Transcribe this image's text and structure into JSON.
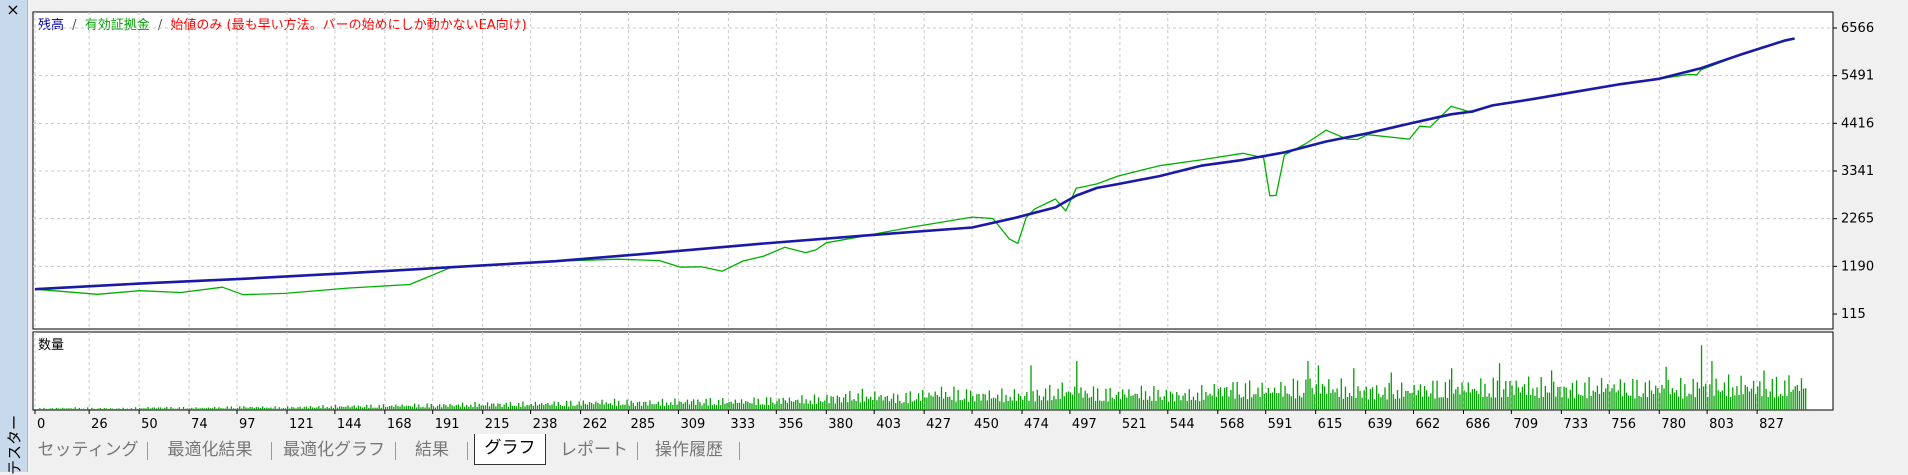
{
  "window": {
    "close_glyph": "×",
    "side_label": "テスター"
  },
  "legend": {
    "balance": "残高",
    "equity": "有効証拠金",
    "note": "始値のみ (最も早い方法。バーの始めにしか動かないEA向け)",
    "separator": "/",
    "colors": {
      "balance": "#0000a0",
      "equity": "#00a000",
      "note": "#ff0000"
    }
  },
  "volume_label": "数量",
  "tabs": [
    {
      "label": "セッティング",
      "active": false
    },
    {
      "label": "最適化結果",
      "active": false
    },
    {
      "label": "最適化グラフ",
      "active": false
    },
    {
      "label": "結果",
      "active": false
    },
    {
      "label": "グラフ",
      "active": true
    },
    {
      "label": "レポート",
      "active": false
    },
    {
      "label": "操作履歴",
      "active": false
    }
  ],
  "chart_data": {
    "type": "line",
    "y_ticks": [
      115,
      1190,
      2265,
      3341,
      4416,
      5491,
      6566
    ],
    "ylim": [
      115,
      6566
    ],
    "x_ticks": [
      0,
      26,
      50,
      74,
      97,
      121,
      144,
      168,
      191,
      215,
      238,
      262,
      285,
      309,
      333,
      356,
      380,
      403,
      427,
      450,
      474,
      497,
      521,
      544,
      568,
      591,
      615,
      639,
      662,
      686,
      709,
      733,
      756,
      780,
      803,
      827
    ],
    "xlim": [
      0,
      850
    ],
    "grid": true,
    "colors": {
      "balance": "#1a1aa6",
      "equity": "#00b000",
      "volume": "#00a000"
    },
    "series": [
      {
        "name": "残高",
        "x": [
          0,
          50,
          100,
          150,
          200,
          250,
          300,
          350,
          400,
          450,
          470,
          490,
          500,
          510,
          520,
          540,
          560,
          580,
          600,
          620,
          640,
          660,
          680,
          690,
          700,
          720,
          740,
          760,
          780,
          800,
          820,
          840,
          845
        ],
        "y": [
          675,
          800,
          910,
          1035,
          1170,
          1305,
          1500,
          1705,
          1890,
          2065,
          2275,
          2520,
          2785,
          2960,
          3045,
          3225,
          3460,
          3590,
          3760,
          4005,
          4190,
          4410,
          4620,
          4680,
          4820,
          4970,
          5130,
          5290,
          5420,
          5660,
          5980,
          6280,
          6330
        ]
      },
      {
        "name": "有効証拠金",
        "x": [
          0,
          30,
          50,
          70,
          90,
          100,
          120,
          150,
          180,
          200,
          250,
          280,
          300,
          310,
          320,
          330,
          340,
          350,
          360,
          370,
          375,
          380,
          400,
          420,
          450,
          460,
          468,
          472,
          476,
          480,
          490,
          495,
          500,
          505,
          510,
          520,
          540,
          560,
          580,
          590,
          593,
          596,
          600,
          610,
          620,
          630,
          635,
          640,
          660,
          665,
          670,
          680,
          690,
          700,
          720,
          740,
          760,
          780,
          790,
          794,
          798,
          800,
          820,
          840,
          845
        ],
        "y": [
          675,
          560,
          640,
          600,
          720,
          550,
          580,
          700,
          780,
          1170,
          1305,
          1350,
          1320,
          1170,
          1180,
          1080,
          1310,
          1420,
          1620,
          1500,
          1560,
          1720,
          1890,
          2065,
          2300,
          2270,
          1805,
          1710,
          2290,
          2480,
          2710,
          2440,
          2950,
          3000,
          3050,
          3225,
          3460,
          3590,
          3740,
          3640,
          2780,
          2790,
          3700,
          3950,
          4260,
          4060,
          4050,
          4160,
          4060,
          4350,
          4330,
          4800,
          4660,
          4820,
          4980,
          5130,
          5290,
          5420,
          5490,
          5520,
          5510,
          5620,
          5980,
          6280,
          6330
        ]
      }
    ],
    "volume": {
      "heights": [
        0.03,
        0.04,
        0.03,
        0.05,
        0.04,
        0.06,
        0.05,
        0.07,
        0.08,
        0.09,
        0.1,
        0.12,
        0.12,
        0.14,
        0.16,
        0.15,
        0.18,
        0.17,
        0.2,
        0.22,
        0.3,
        0.25,
        0.35,
        0.3,
        0.3,
        0.4,
        0.33,
        0.35,
        0.3,
        0.45,
        0.4,
        0.5,
        0.42,
        0.38,
        0.45,
        0.45,
        0.5,
        0.43,
        0.48,
        0.46,
        0.45,
        0.5,
        0.48,
        0.52
      ],
      "spikes": [
        [
          478,
          0.62
        ],
        [
          500,
          0.68
        ],
        [
          611,
          0.68
        ],
        [
          616,
          0.62
        ],
        [
          633,
          0.58
        ],
        [
          651,
          0.52
        ],
        [
          680,
          0.58
        ],
        [
          703,
          0.65
        ],
        [
          728,
          0.55
        ],
        [
          783,
          0.6
        ],
        [
          800,
          0.9
        ],
        [
          805,
          0.68
        ],
        [
          830,
          0.55
        ]
      ]
    }
  }
}
